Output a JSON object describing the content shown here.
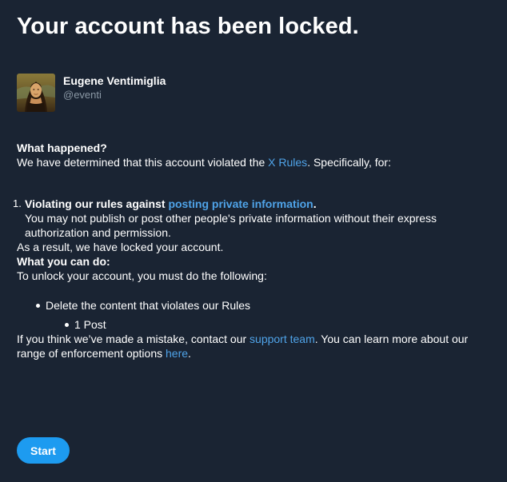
{
  "page_title": "Your account has been locked.",
  "profile": {
    "display_name": "Eugene Ventimiglia",
    "handle": "@eventi",
    "avatar_icon": "mona-lisa-avatar"
  },
  "what_happened": {
    "heading": "What happened?",
    "text_before_link": "We have determined that this account violated the ",
    "rules_link": "X Rules",
    "text_after_link": ". Specifically, for:"
  },
  "violations": [
    {
      "number": "1.",
      "label_before_link": "Violating our rules against ",
      "link": "posting private information",
      "label_after_link": ".",
      "description": "You may not publish or post other people's private information without their express authorization and permission."
    }
  ],
  "result_text": "As a result, we have locked your account.",
  "what_you_can_do": {
    "heading": "What you can do:",
    "body": "To unlock your account, you must do the following:"
  },
  "actions": [
    {
      "label": "Delete the content that violates our Rules",
      "sub_items": [
        "1 Post"
      ]
    }
  ],
  "mistake": {
    "text_before_link": "If you think we’ve made a mistake, contact our ",
    "support_link": "support team",
    "text_middle": ". You can learn more about our range of enforcement options ",
    "here_link": "here",
    "text_end": "."
  },
  "start_button_label": "Start",
  "colors": {
    "background": "#1a2433",
    "link": "#4fa3e8",
    "button": "#1d9bf0",
    "secondary_text": "#8b98a5"
  }
}
